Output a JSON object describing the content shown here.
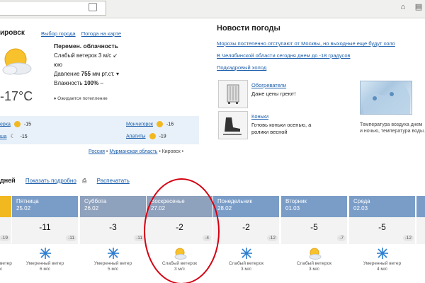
{
  "current": {
    "city": "ировск",
    "links": [
      "Выбор города",
      "Погода на карте"
    ],
    "temperature": "-17°C",
    "condition": "Перемен. облачность",
    "wind": "Слабый ветерок 3 м/с",
    "wind_dir": "юю",
    "pressure_label": "Давление",
    "pressure_value": "755",
    "pressure_unit": "мм рт.ст.",
    "humidity_label": "Влажность",
    "humidity_value": "100%",
    "warming": "Ожидается потепление"
  },
  "neighbors": [
    {
      "name": "ерка",
      "temp": "-15",
      "icon": "sun-icon"
    },
    {
      "name": "Мончегорск",
      "temp": "-16",
      "icon": "sun-icon"
    },
    {
      "name": "ша",
      "temp": "-15",
      "icon": "moon-icon"
    },
    {
      "name": "Апатиты",
      "temp": "-19",
      "icon": "sun-icon"
    }
  ],
  "breadcrumb": {
    "country": "Россия",
    "region": "Мурманская область",
    "city": "Кировск"
  },
  "news": {
    "title": "Новости погоды",
    "items": [
      "Морозы постепенно отступают от Москвы, но выходные еще будут холо",
      "В Челябинской области сегодня днем до -18 градусов",
      "Подкадровый холод"
    ],
    "promos": [
      {
        "link": "Обогреватели",
        "text": "Даже цены греют!",
        "icon": "heater-icon"
      },
      {
        "link": "Коньки",
        "text": "Готовь коньки осенью, а ролики весной",
        "icon": "skates-icon"
      }
    ],
    "map_caption": "Температура воздуха днем и ночью, температура воды."
  },
  "forecast": {
    "head": "дней",
    "detail_link": "Показать подробно",
    "print_link": "Распечатать",
    "partial_left": {
      "low": "-19",
      "weather": "ветер",
      "speed": "с"
    },
    "days": [
      {
        "name": "Пятница",
        "date": "25.02",
        "temp": "-11",
        "low": "-11",
        "weather": "Умеренный ветер",
        "speed": "6 м/с",
        "icon": "snowflake-icon"
      },
      {
        "name": "Суббота",
        "date": "26.02",
        "temp": "-3",
        "low": "-11",
        "weather": "Умеренный ветер",
        "speed": "5 м/с",
        "icon": "snowflake-icon"
      },
      {
        "name": "Воскресенье",
        "date": "27.02",
        "temp": "-2",
        "low": "-4",
        "weather": "Слабый ветерок",
        "speed": "3 м/с",
        "icon": "sun-cloud-icon"
      },
      {
        "name": "Понедельник",
        "date": "28.02",
        "temp": "-2",
        "low": "-12",
        "weather": "Слабый ветерок",
        "speed": "3 м/с",
        "icon": "snowflake-icon"
      },
      {
        "name": "Вторник",
        "date": "01.03",
        "temp": "-5",
        "low": "-7",
        "weather": "Слабый ветерок",
        "speed": "3 м/с",
        "icon": "sun-cloud-icon"
      },
      {
        "name": "Среда",
        "date": "02.03",
        "temp": "-5",
        "low": "-12",
        "weather": "Умеренный ветер",
        "speed": "4 м/с",
        "icon": "snowflake-icon"
      }
    ]
  },
  "colors": {
    "day_header_blue": "#7a9dc8",
    "day_header_gray": "#8ea1bd",
    "accent_orange": "#f2b820",
    "link": "#1a5dab",
    "annotation_red": "#d40010"
  }
}
